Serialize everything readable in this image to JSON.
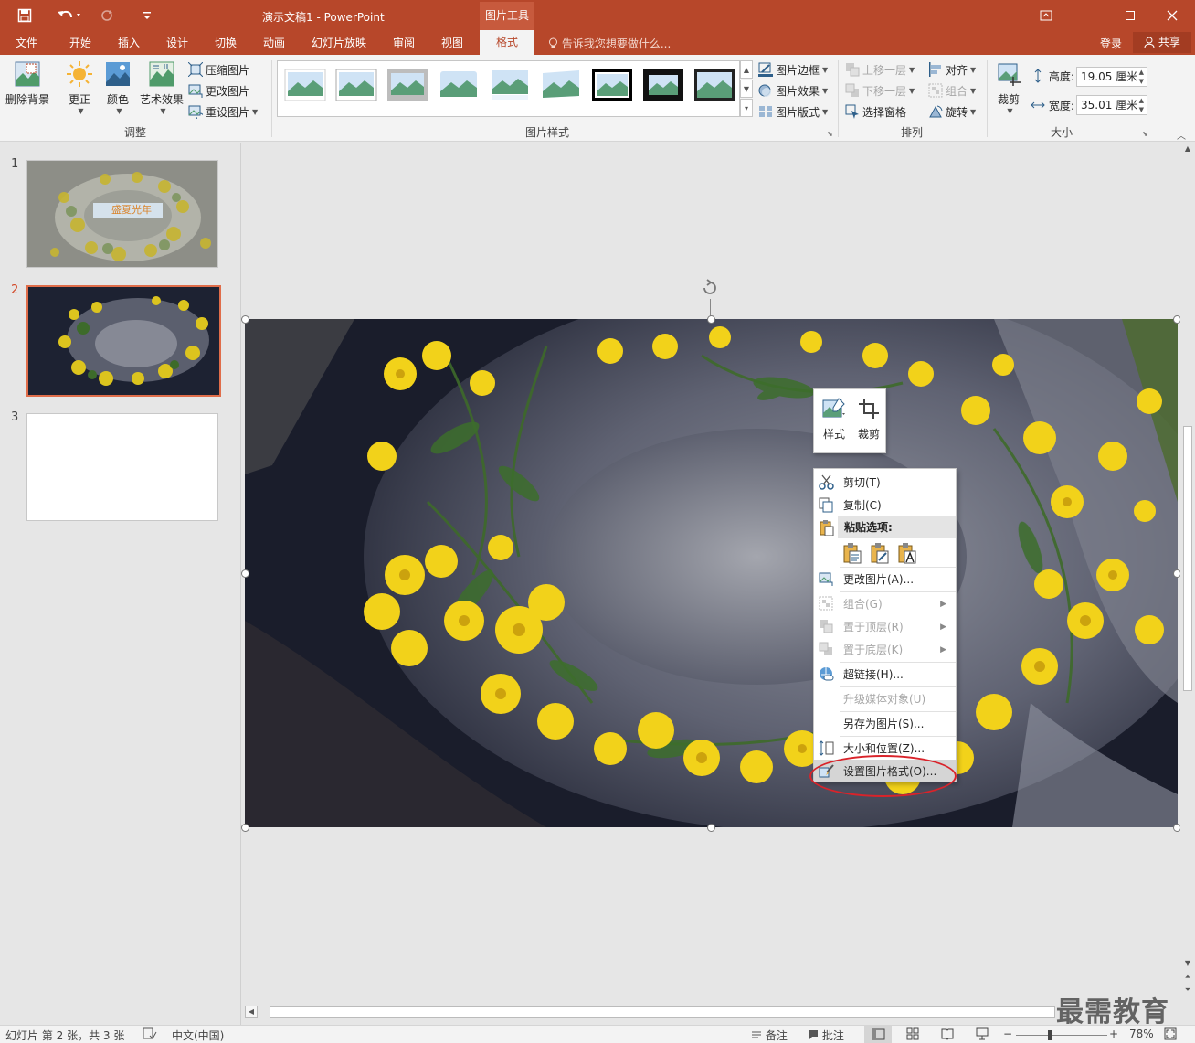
{
  "titlebar": {
    "doc_title": "演示文稿1 - PowerPoint",
    "context_tab_header": "图片工具",
    "qat": {
      "save_icon": "save-icon",
      "undo_icon": "undo-icon",
      "redo_icon": "redo-icon",
      "customize_icon": "customize-qat-icon"
    }
  },
  "tabs": [
    "文件",
    "开始",
    "插入",
    "设计",
    "切换",
    "动画",
    "幻灯片放映",
    "审阅",
    "视图"
  ],
  "active_tab": "格式",
  "tellme": "告诉我您想要做什么...",
  "login": "登录",
  "share": "共享",
  "ribbon": {
    "adjust": {
      "remove_bg": "删除背景",
      "corrections": "更正",
      "color": "颜色",
      "artistic": "艺术效果",
      "compress": "压缩图片",
      "change": "更改图片",
      "reset": "重设图片",
      "label": "调整"
    },
    "styles": {
      "border": "图片边框",
      "effects": "图片效果",
      "layout": "图片版式",
      "label": "图片样式"
    },
    "arrange": {
      "bring_forward": "上移一层",
      "send_backward": "下移一层",
      "selection_pane": "选择窗格",
      "align": "对齐",
      "group": "组合",
      "rotate": "旋转",
      "label": "排列"
    },
    "size": {
      "crop": "裁剪",
      "height_label": "高度:",
      "height_value": "19.05 厘米",
      "width_label": "宽度:",
      "width_value": "35.01 厘米",
      "label": "大小"
    }
  },
  "slides": [
    {
      "num": "1",
      "caption": "盛夏光年"
    },
    {
      "num": "2"
    },
    {
      "num": "3"
    }
  ],
  "mini_toolbar": {
    "style": "样式",
    "crop": "裁剪"
  },
  "context_menu": {
    "cut": "剪切(T)",
    "copy": "复制(C)",
    "paste_options": "粘贴选项:",
    "change_picture": "更改图片(A)...",
    "group": "组合(G)",
    "bring_front": "置于顶层(R)",
    "send_back": "置于底层(K)",
    "hyperlink": "超链接(H)...",
    "upgrade_media": "升级媒体对象(U)",
    "save_as_picture": "另存为图片(S)...",
    "size_position": "大小和位置(Z)...",
    "format_picture": "设置图片格式(O)..."
  },
  "statusbar": {
    "slide_info": "幻灯片 第 2 张，共 3 张",
    "language": "中文(中国)",
    "notes": "备注",
    "comments": "批注",
    "zoom": "78%"
  },
  "watermark": "最需教育",
  "colors": {
    "accent": "#b7472a",
    "highlight_ring": "#d9232a"
  }
}
